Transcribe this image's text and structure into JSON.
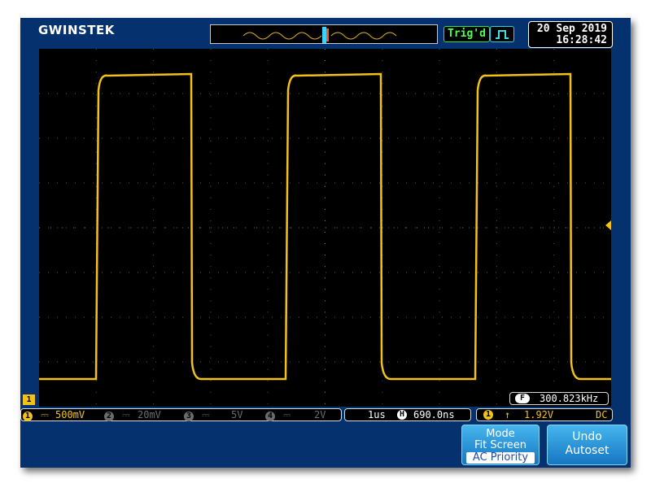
{
  "brand": {
    "logo": "GWINSTEK"
  },
  "header": {
    "trig_status": "Trig'd",
    "trigger_icon": "rising-pulse-icon",
    "date": "20 Sep 2019",
    "time": "16:28:42"
  },
  "channel_marker": "1",
  "frequency": {
    "badge": "F",
    "value": "300.823kHz"
  },
  "channels": [
    {
      "num": "1",
      "coupling": "⎓",
      "scale": "500mV",
      "active": true
    },
    {
      "num": "2",
      "coupling": "⎓",
      "scale": "20mV",
      "active": false
    },
    {
      "num": "3",
      "coupling": "⎓",
      "scale": "5V",
      "active": false
    },
    {
      "num": "4",
      "coupling": "⎓",
      "scale": "2V",
      "active": false
    }
  ],
  "timebase": {
    "scale": "1us",
    "h_icon": "H",
    "position": "690.0ns"
  },
  "trigger": {
    "source": "1",
    "slope": "↑",
    "level": "1.92V",
    "coupling": "DC"
  },
  "buttons": {
    "mode": {
      "title": "Mode",
      "option1": "Fit Screen",
      "option2": "AC Priority"
    },
    "undo": {
      "line1": "Undo",
      "line2": "Autoset"
    }
  },
  "colors": {
    "ch1": "#f2c21a",
    "background": "#05326e",
    "trig_ok": "#50ff50"
  },
  "waveform": {
    "type": "square",
    "low_level": "low",
    "high_level": "high",
    "periods_shown": 3
  }
}
